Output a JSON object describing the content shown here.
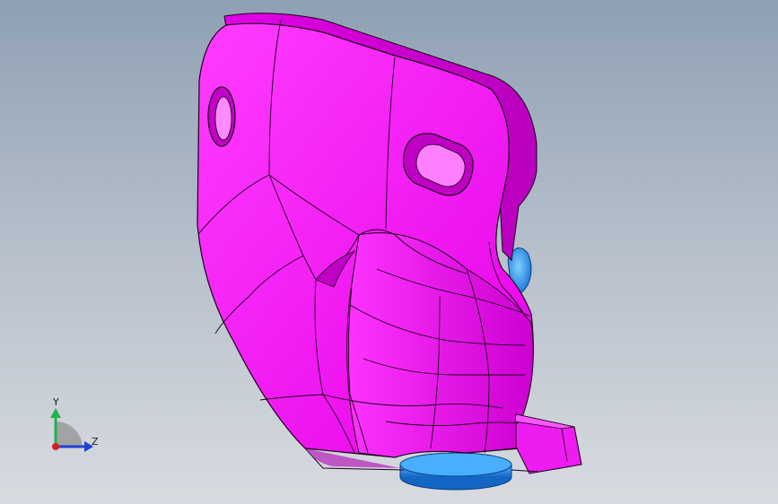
{
  "viewport": {
    "background_top": "#8fa0b4",
    "background_bottom": "#d8dbe0"
  },
  "model": {
    "part_color": "#ff00ff",
    "part_shade": "#c400c8",
    "part_highlight": "#ff66ff",
    "hardware_color": "#1e90ff",
    "hardware_shade": "#0b5fb8",
    "edge_color": "#1a001a"
  },
  "triad": {
    "y_label": "Y",
    "z_label": "Z",
    "y_color": "#22b14c",
    "z_color": "#1f3fd6",
    "x_color": "#d42020",
    "orientation_icon": "view-orientation-triad-icon"
  }
}
